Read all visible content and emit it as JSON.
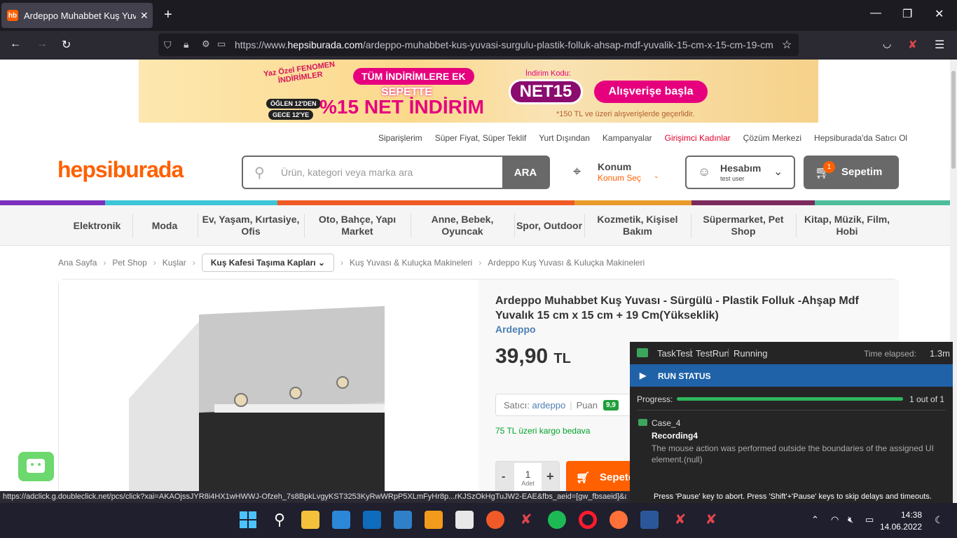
{
  "browser": {
    "tab_title": "Ardeppo Muhabbet Kuş Yuvası",
    "favicon_text": "hb",
    "url_prefix": "https://www.",
    "url_domain": "hepsiburada.com",
    "url_path": "/ardeppo-muhabbet-kus-yuvasi-surgulu-plastik-folluk-ahsap-mdf-yuvalik-15-cm-x-15-cm-19-cm"
  },
  "banner": {
    "line1": "TÜM İNDİRİMLERE EK",
    "line2": "SEPETTE",
    "line3": "%15 NET İNDİRİM",
    "code_label": "İndirim Kodu:",
    "code": "NET15",
    "cta": "Alışverişe başla",
    "note": "*150 TL ve üzeri alışverişlerde geçerlidir.",
    "badge": "Yaz Özel FENOMEN İNDİRİMLER",
    "time1": "ÖĞLEN 12'DEN",
    "time2": "GECE 12'YE"
  },
  "topnav": [
    "Siparişlerim",
    "Süper Fiyat, Süper Teklif",
    "Yurt Dışından",
    "Kampanyalar",
    "Girişimci Kadınlar",
    "Çözüm Merkezi",
    "Hepsiburada'da Satıcı Ol"
  ],
  "header": {
    "logo": "hepsiburada",
    "search_placeholder": "Ürün, kategori veya marka ara",
    "search_button": "ARA",
    "konum_title": "Konum",
    "konum_sub": "Konum Seç",
    "account_title": "Hesabım",
    "account_user": "test user",
    "cart_label": "Sepetim",
    "cart_count": "1"
  },
  "categories": [
    "Elektronik",
    "Moda",
    "Ev, Yaşam, Kırtasiye, Ofis",
    "Oto, Bahçe, Yapı Market",
    "Anne, Bebek, Oyuncak",
    "Spor, Outdoor",
    "Kozmetik, Kişisel Bakım",
    "Süpermarket, Pet Shop",
    "Kitap, Müzik, Film, Hobi"
  ],
  "breadcrumbs": {
    "items": [
      "Ana Sayfa",
      "Pet Shop",
      "Kuşlar"
    ],
    "dropdown": "Kuş Kafesi Taşıma Kapları",
    "tail": [
      "Kuş Yuvası & Kuluçka Makineleri",
      "Ardeppo Kuş Yuvası & Kuluçka Makineleri"
    ]
  },
  "product": {
    "title": "Ardeppo Muhabbet Kuş Yuvası - Sürgülü - Plastik Folluk -Ahşap Mdf Yuvalık 15 cm x 15 cm + 19 Cm(Yükseklik)",
    "brand": "Ardeppo",
    "price": "39,90",
    "currency": "TL",
    "seller_label": "Satıcı:",
    "seller": "ardeppo",
    "rating_label": "Puan",
    "rating": "9,9",
    "shipping": "75 TL üzeri kargo bedava",
    "qty": "1",
    "qty_unit": "Adet",
    "minus": "-",
    "plus": "+",
    "add_to_cart": "Sepete"
  },
  "runner": {
    "task": "TaskTest",
    "run": "TestRun",
    "state": "Running",
    "elapsed_label": "Time elapsed:",
    "elapsed": "1.3m",
    "run_status": "RUN STATUS",
    "progress_label": "Progress:",
    "progress_text": "1 out of 1",
    "progress_fraction": 1.0,
    "case": "Case_4",
    "recording": "Recording4",
    "message": "The mouse action was performed outside the boundaries of the assigned UI element.(null)",
    "footer": "Press 'Pause' key to abort. Press 'Shift'+'Pause' keys to skip delays and timeouts."
  },
  "statusbar": {
    "link": "https://adclick.g.doubleclick.net/pcs/click?xai=AKAOjssJYR8i4HX1wHWWJ-Ofzeh_7s8BpkLvgyKST3253KyRwWRpP5XLmFyHr8p...rKJSzOkHgTuJW2-EAE&fbs_aeid=[gw_fbsaeid]&adurl=https://www.hepsiburada.com/..."
  },
  "taskbar": {
    "time": "14:38",
    "date": "14.06.2022"
  },
  "colors": {
    "brand_orange": "#ff6000",
    "runner_blue": "#1f62a8",
    "progress_green": "#2eb85c"
  }
}
